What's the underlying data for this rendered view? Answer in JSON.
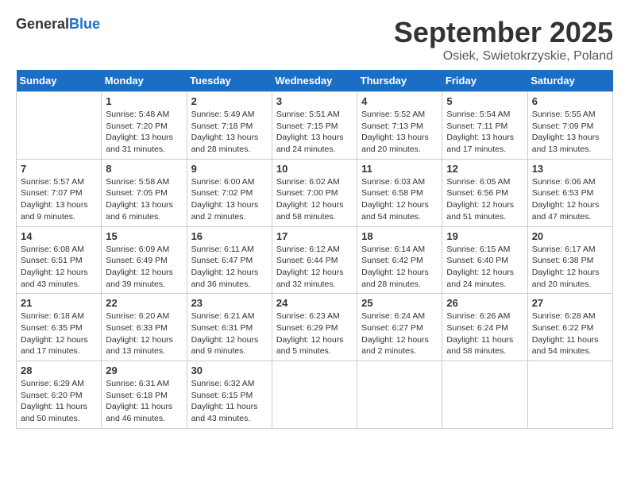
{
  "header": {
    "logo_general": "General",
    "logo_blue": "Blue",
    "title": "September 2025",
    "subtitle": "Osiek, Swietokrzyskie, Poland"
  },
  "days_of_week": [
    "Sunday",
    "Monday",
    "Tuesday",
    "Wednesday",
    "Thursday",
    "Friday",
    "Saturday"
  ],
  "weeks": [
    [
      {
        "day": "",
        "info": ""
      },
      {
        "day": "1",
        "info": "Sunrise: 5:48 AM\nSunset: 7:20 PM\nDaylight: 13 hours and 31 minutes."
      },
      {
        "day": "2",
        "info": "Sunrise: 5:49 AM\nSunset: 7:18 PM\nDaylight: 13 hours and 28 minutes."
      },
      {
        "day": "3",
        "info": "Sunrise: 5:51 AM\nSunset: 7:15 PM\nDaylight: 13 hours and 24 minutes."
      },
      {
        "day": "4",
        "info": "Sunrise: 5:52 AM\nSunset: 7:13 PM\nDaylight: 13 hours and 20 minutes."
      },
      {
        "day": "5",
        "info": "Sunrise: 5:54 AM\nSunset: 7:11 PM\nDaylight: 13 hours and 17 minutes."
      },
      {
        "day": "6",
        "info": "Sunrise: 5:55 AM\nSunset: 7:09 PM\nDaylight: 13 hours and 13 minutes."
      }
    ],
    [
      {
        "day": "7",
        "info": "Sunrise: 5:57 AM\nSunset: 7:07 PM\nDaylight: 13 hours and 9 minutes."
      },
      {
        "day": "8",
        "info": "Sunrise: 5:58 AM\nSunset: 7:05 PM\nDaylight: 13 hours and 6 minutes."
      },
      {
        "day": "9",
        "info": "Sunrise: 6:00 AM\nSunset: 7:02 PM\nDaylight: 13 hours and 2 minutes."
      },
      {
        "day": "10",
        "info": "Sunrise: 6:02 AM\nSunset: 7:00 PM\nDaylight: 12 hours and 58 minutes."
      },
      {
        "day": "11",
        "info": "Sunrise: 6:03 AM\nSunset: 6:58 PM\nDaylight: 12 hours and 54 minutes."
      },
      {
        "day": "12",
        "info": "Sunrise: 6:05 AM\nSunset: 6:56 PM\nDaylight: 12 hours and 51 minutes."
      },
      {
        "day": "13",
        "info": "Sunrise: 6:06 AM\nSunset: 6:53 PM\nDaylight: 12 hours and 47 minutes."
      }
    ],
    [
      {
        "day": "14",
        "info": "Sunrise: 6:08 AM\nSunset: 6:51 PM\nDaylight: 12 hours and 43 minutes."
      },
      {
        "day": "15",
        "info": "Sunrise: 6:09 AM\nSunset: 6:49 PM\nDaylight: 12 hours and 39 minutes."
      },
      {
        "day": "16",
        "info": "Sunrise: 6:11 AM\nSunset: 6:47 PM\nDaylight: 12 hours and 36 minutes."
      },
      {
        "day": "17",
        "info": "Sunrise: 6:12 AM\nSunset: 6:44 PM\nDaylight: 12 hours and 32 minutes."
      },
      {
        "day": "18",
        "info": "Sunrise: 6:14 AM\nSunset: 6:42 PM\nDaylight: 12 hours and 28 minutes."
      },
      {
        "day": "19",
        "info": "Sunrise: 6:15 AM\nSunset: 6:40 PM\nDaylight: 12 hours and 24 minutes."
      },
      {
        "day": "20",
        "info": "Sunrise: 6:17 AM\nSunset: 6:38 PM\nDaylight: 12 hours and 20 minutes."
      }
    ],
    [
      {
        "day": "21",
        "info": "Sunrise: 6:18 AM\nSunset: 6:35 PM\nDaylight: 12 hours and 17 minutes."
      },
      {
        "day": "22",
        "info": "Sunrise: 6:20 AM\nSunset: 6:33 PM\nDaylight: 12 hours and 13 minutes."
      },
      {
        "day": "23",
        "info": "Sunrise: 6:21 AM\nSunset: 6:31 PM\nDaylight: 12 hours and 9 minutes."
      },
      {
        "day": "24",
        "info": "Sunrise: 6:23 AM\nSunset: 6:29 PM\nDaylight: 12 hours and 5 minutes."
      },
      {
        "day": "25",
        "info": "Sunrise: 6:24 AM\nSunset: 6:27 PM\nDaylight: 12 hours and 2 minutes."
      },
      {
        "day": "26",
        "info": "Sunrise: 6:26 AM\nSunset: 6:24 PM\nDaylight: 11 hours and 58 minutes."
      },
      {
        "day": "27",
        "info": "Sunrise: 6:28 AM\nSunset: 6:22 PM\nDaylight: 11 hours and 54 minutes."
      }
    ],
    [
      {
        "day": "28",
        "info": "Sunrise: 6:29 AM\nSunset: 6:20 PM\nDaylight: 11 hours and 50 minutes."
      },
      {
        "day": "29",
        "info": "Sunrise: 6:31 AM\nSunset: 6:18 PM\nDaylight: 11 hours and 46 minutes."
      },
      {
        "day": "30",
        "info": "Sunrise: 6:32 AM\nSunset: 6:15 PM\nDaylight: 11 hours and 43 minutes."
      },
      {
        "day": "",
        "info": ""
      },
      {
        "day": "",
        "info": ""
      },
      {
        "day": "",
        "info": ""
      },
      {
        "day": "",
        "info": ""
      }
    ]
  ]
}
